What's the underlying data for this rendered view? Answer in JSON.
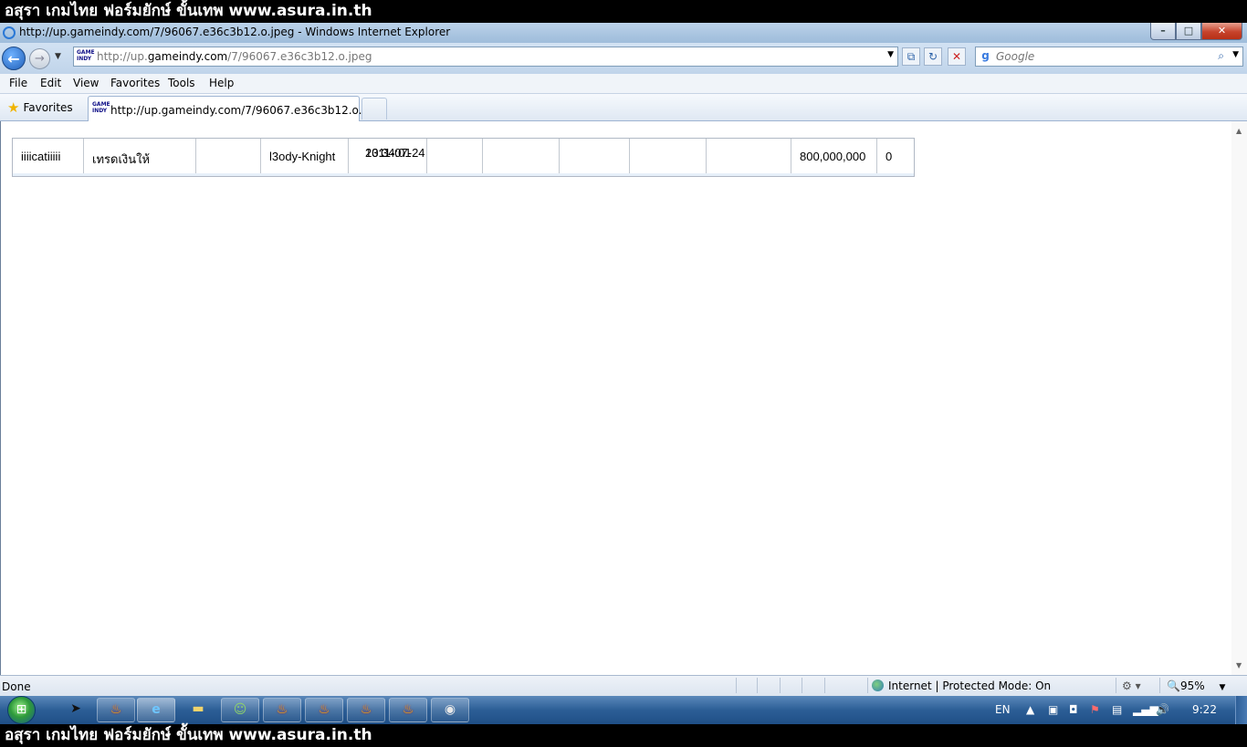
{
  "banner_text": "อสุรา เกมไทย ฟอร์มยักษ์ ขั้นเทพ www.asura.in.th",
  "window": {
    "title": "http://up.gameindy.com/7/96067.e36c3b12.o.jpeg - Windows Internet Explorer",
    "min_label": "–",
    "max_label": "□",
    "close_label": "✕"
  },
  "nav": {
    "back_glyph": "←",
    "forward_glyph": "→",
    "address_host": "http://up.",
    "address_domain": "gameindy.com",
    "address_path": "/7/96067.e36c3b12.o.jpeg",
    "search_placeholder": "Google"
  },
  "site_icon_text": {
    "line1": "GAME",
    "line2": "INDY"
  },
  "menu": {
    "file": "File",
    "edit": "Edit",
    "view": "View",
    "favorites": "Favorites",
    "tools": "Tools",
    "help": "Help"
  },
  "favorites_label": "Favorites",
  "tab_title": "http://up.gameindy.com/7/96067.e36c3b12.o.jpeg",
  "record": {
    "col1": "iiiicatiiiii",
    "col2": "เทรดเงินให้",
    "col3": "",
    "col4": "l3ody-Knight",
    "date": "2011-07-24",
    "time": "13:34:01",
    "amount": "800,000,000",
    "last": "0"
  },
  "status": {
    "text": "Done",
    "zone": "Internet | Protected Mode: On",
    "zoom": "95%"
  },
  "tray": {
    "lang": "EN",
    "clock": "9:22"
  },
  "colors": {
    "banner_bg": "#000000",
    "taskbar": "#2c5e96",
    "close_button": "#c6432c"
  }
}
